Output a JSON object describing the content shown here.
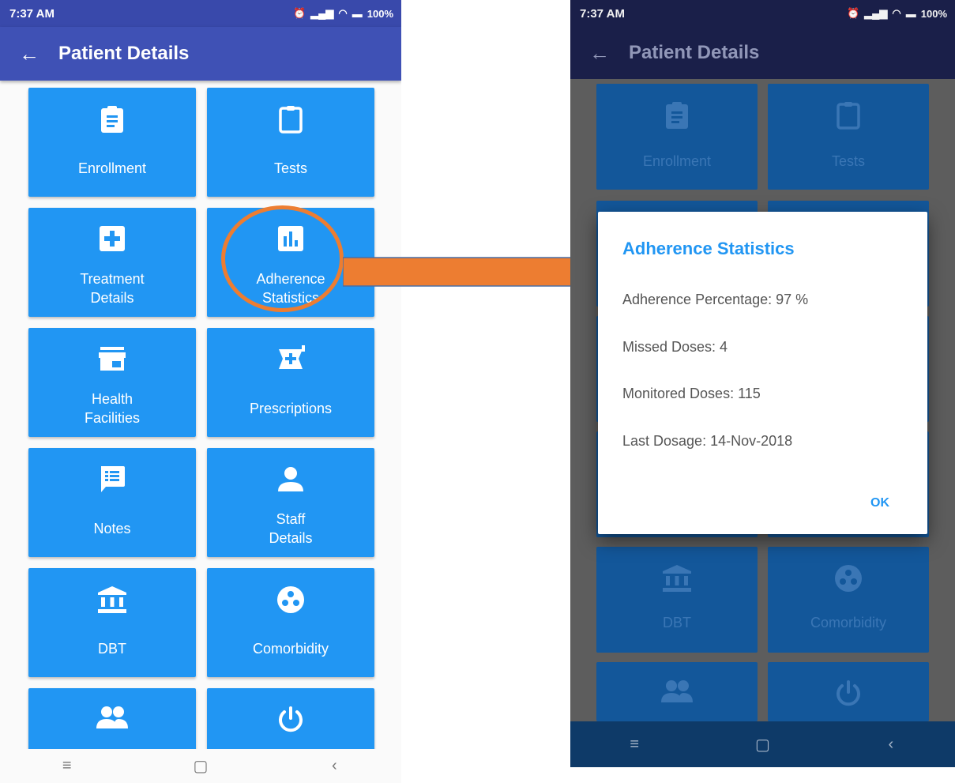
{
  "status": {
    "time": "7:37 AM",
    "battery": "100%"
  },
  "appbar": {
    "back_icon": "arrow-left-icon",
    "title": "Patient Details"
  },
  "tiles": [
    {
      "label": "Enrollment",
      "icon": "clipboard-text-icon"
    },
    {
      "label": "Tests",
      "icon": "clipboard-empty-icon"
    },
    {
      "label_lines": [
        "Treatment",
        "Details"
      ],
      "icon": "medical-plus-icon"
    },
    {
      "label_lines": [
        "Adherence",
        "Statistics"
      ],
      "icon": "bar-chart-icon"
    },
    {
      "label_lines": [
        "Health",
        "Facilities"
      ],
      "icon": "store-icon"
    },
    {
      "label": "Prescriptions",
      "icon": "mortar-plus-icon"
    },
    {
      "label": "Notes",
      "icon": "note-list-icon"
    },
    {
      "label_lines": [
        "Staff",
        "Details"
      ],
      "icon": "person-icon"
    },
    {
      "label": "DBT",
      "icon": "bank-icon"
    },
    {
      "label": "Comorbidity",
      "icon": "dots-circle-icon"
    },
    {
      "icon": "people-icon"
    },
    {
      "icon": "power-icon"
    }
  ],
  "dialog": {
    "title": "Adherence Statistics",
    "lines": [
      "Adherence Percentage: 97 %",
      "Missed Doses: 4",
      "Monitored Doses: 115",
      "Last Dosage: 14-Nov-2018"
    ],
    "ok_label": "OK"
  },
  "navbar": {
    "menu": "≡",
    "home": "▢",
    "back": "‹"
  },
  "colors": {
    "accent": "#2196f3",
    "appbar": "#3f51b5",
    "highlight": "#ed7d31"
  }
}
